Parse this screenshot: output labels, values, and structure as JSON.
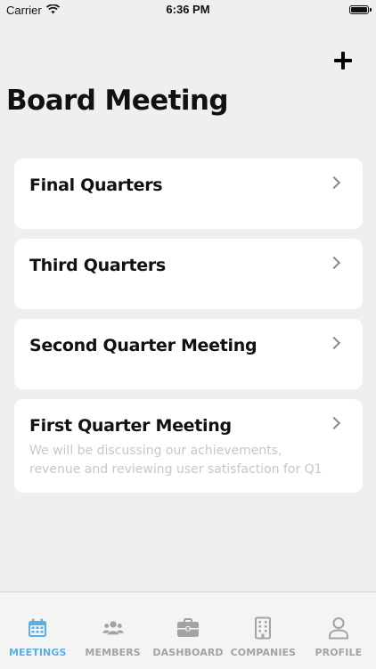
{
  "status_bar": {
    "carrier": "Carrier",
    "time": "6:36 PM"
  },
  "header": {
    "title": "Board Meeting",
    "add_icon": "plus-icon"
  },
  "meetings": [
    {
      "title": "Final Quarters",
      "description": ""
    },
    {
      "title": "Third Quarters",
      "description": ""
    },
    {
      "title": "Second Quarter Meeting",
      "description": ""
    },
    {
      "title": "First Quarter Meeting",
      "description": "We will be discussing our achievements, revenue and reviewing user satisfaction for Q1"
    }
  ],
  "tab_bar": {
    "active_color": "#5ab0e3",
    "inactive_color": "#a3a3a3",
    "tabs": [
      {
        "label": "MEETINGS",
        "icon": "calendar-icon",
        "active": true
      },
      {
        "label": "MEMBERS",
        "icon": "members-icon",
        "active": false
      },
      {
        "label": "DASHBOARD",
        "icon": "briefcase-icon",
        "active": false
      },
      {
        "label": "COMPANIES",
        "icon": "building-icon",
        "active": false
      },
      {
        "label": "PROFILE",
        "icon": "person-icon",
        "active": false
      }
    ]
  }
}
